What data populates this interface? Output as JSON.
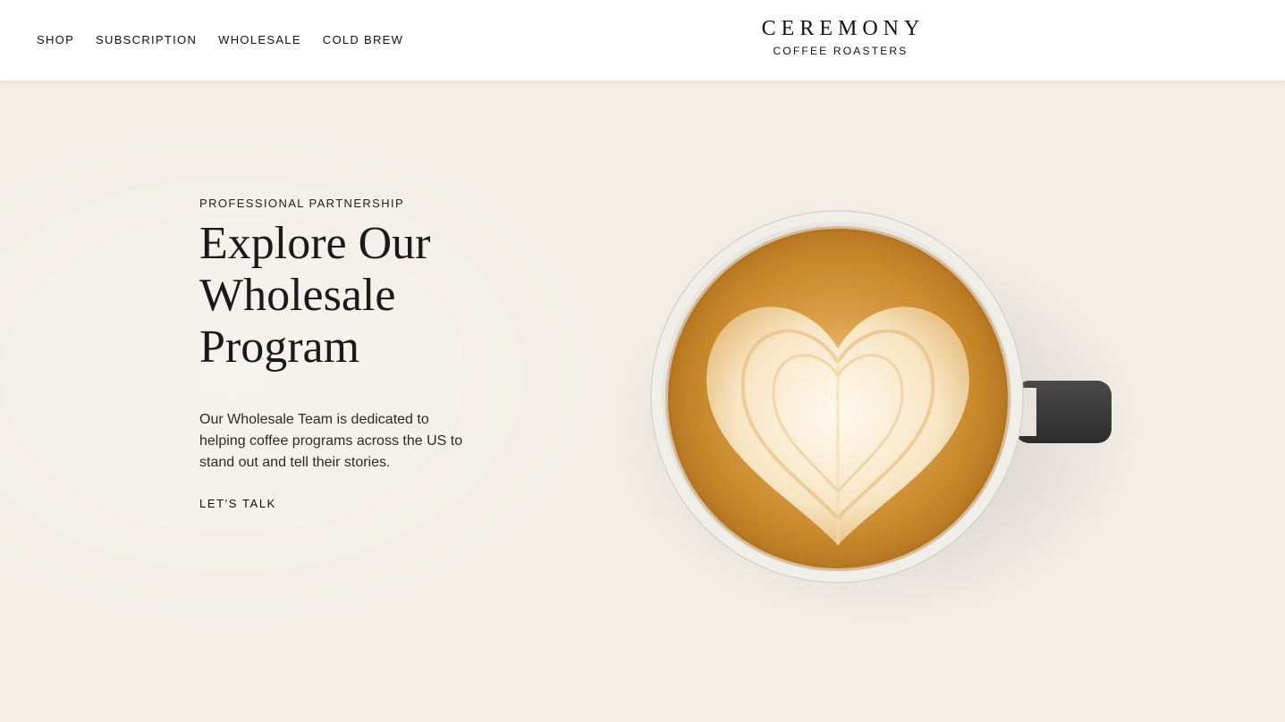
{
  "header": {
    "nav": [
      {
        "label": "SHOP"
      },
      {
        "label": "SUBSCRIPTION"
      },
      {
        "label": "WHOLESALE"
      },
      {
        "label": "COLD BREW"
      }
    ],
    "brand": {
      "name": "CEREMONY",
      "subtitle": "COFFEE ROASTERS"
    }
  },
  "hero": {
    "eyebrow": "PROFESSIONAL PARTNERSHIP",
    "headline": "Explore Our Wholesale Program",
    "body": "Our Wholesale Team is dedicated to helping coffee programs across the US to stand out and tell their stories.",
    "cta_label": "LET'S TALK",
    "image": {
      "icon": "latte-art-cup-image"
    }
  },
  "colors": {
    "background": "#f2eee6",
    "header_bg": "#ffffff",
    "text": "#1b1b1b",
    "crema": "#c98a2c",
    "mug": "#3a3a3a"
  }
}
